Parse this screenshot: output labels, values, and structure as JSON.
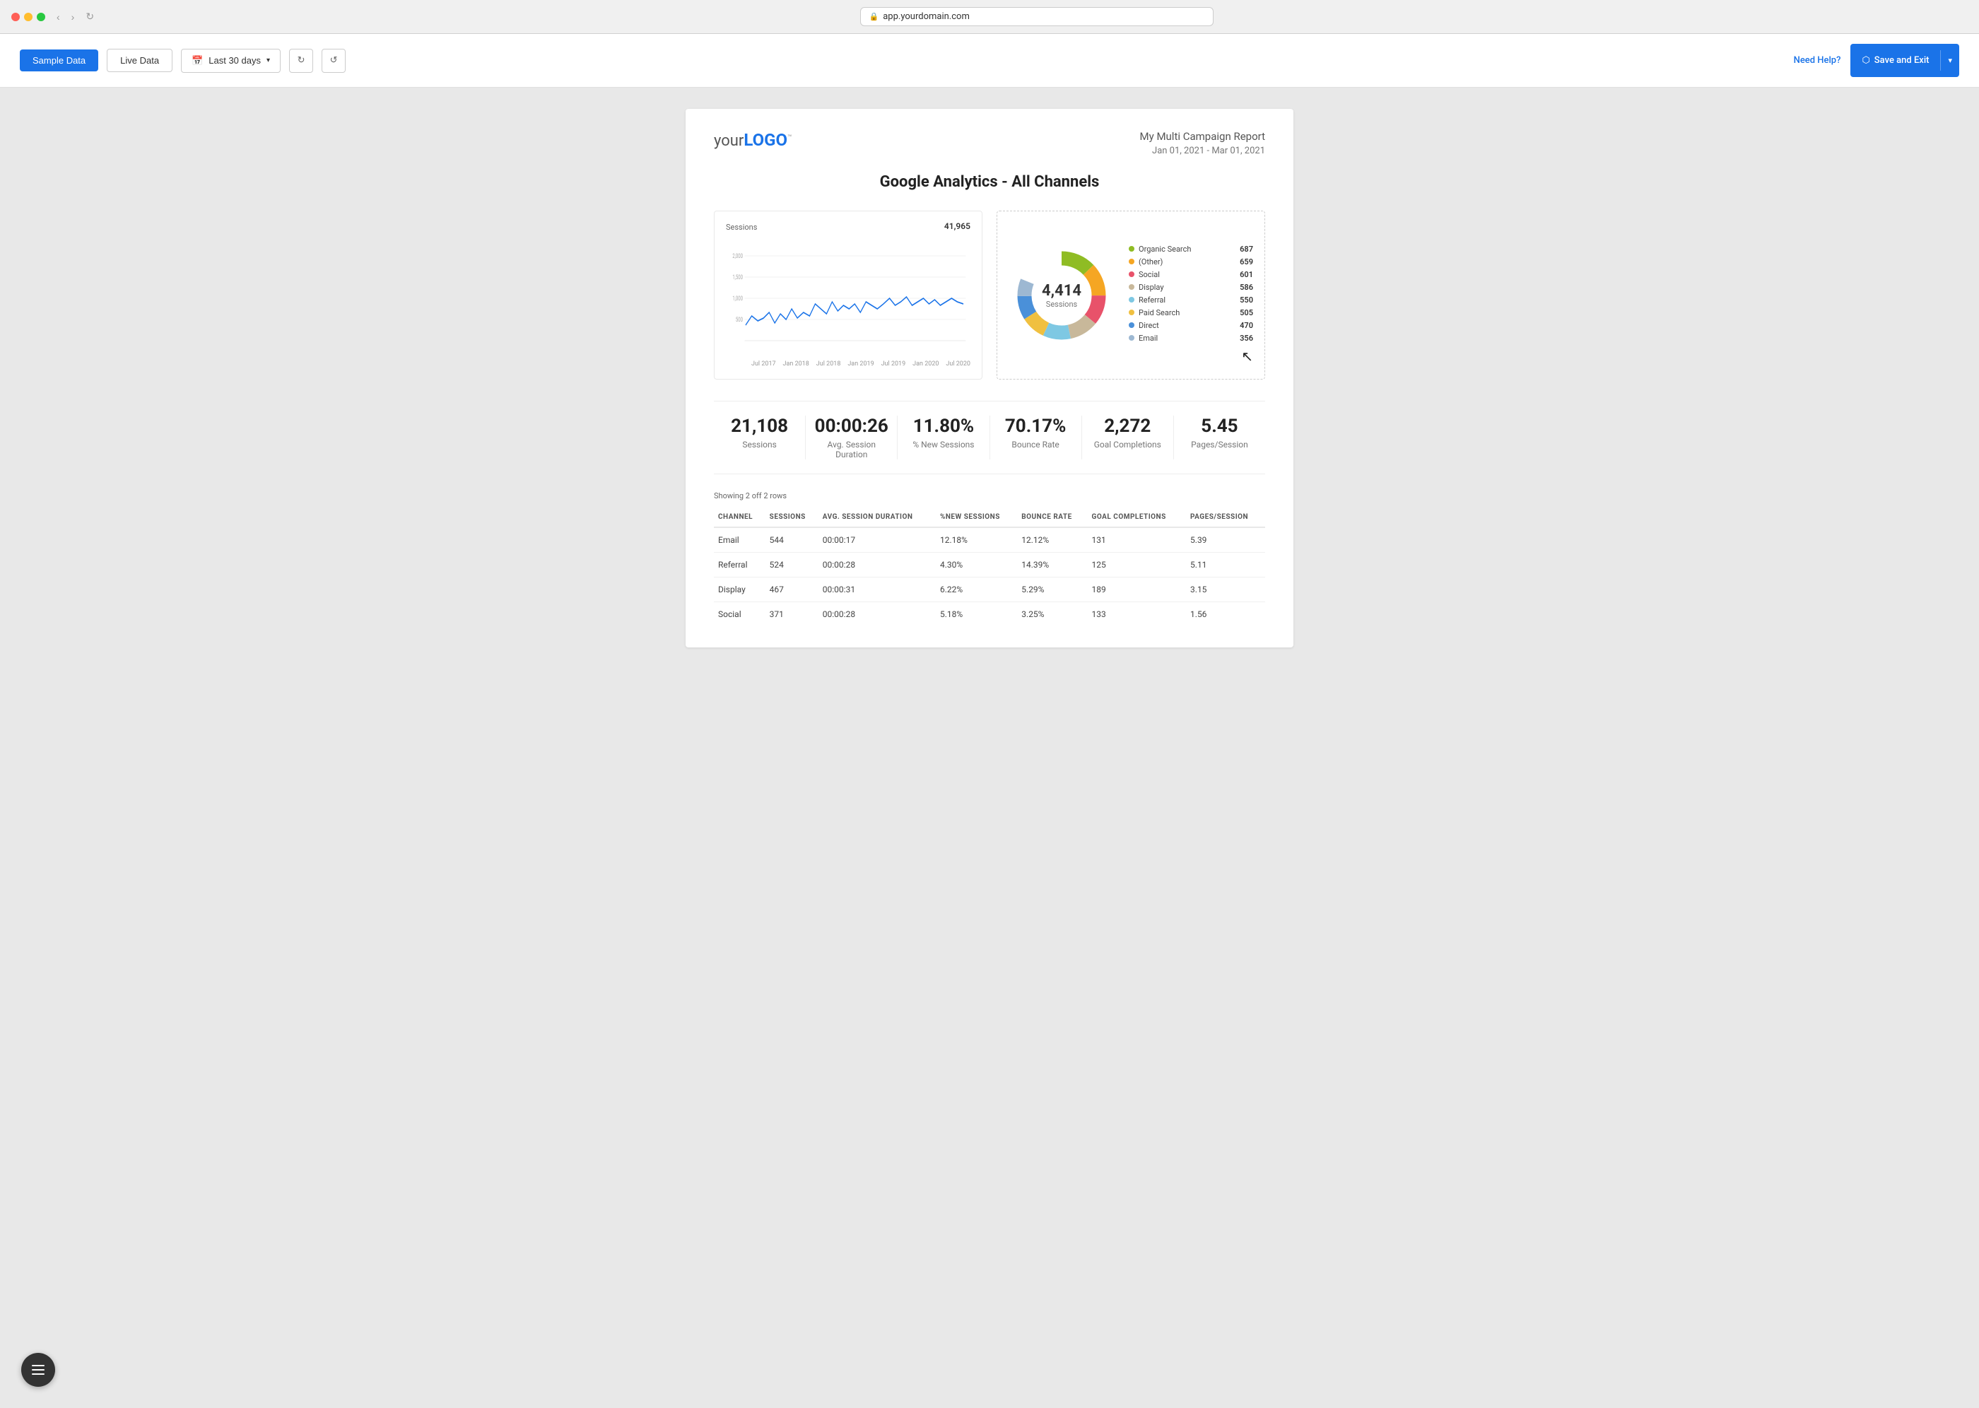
{
  "browser": {
    "url": "app.yourdomain.com"
  },
  "toolbar": {
    "sample_data_label": "Sample Data",
    "live_data_label": "Live Data",
    "date_range_label": "Last 30 days",
    "need_help_label": "Need Help?",
    "save_exit_label": "Save and Exit"
  },
  "report": {
    "logo_text": "your",
    "logo_bold": "LOGO",
    "logo_tm": "™",
    "report_name": "My Multi Campaign Report",
    "report_date": "Jan 01, 2021 - Mar 01, 2021",
    "section_title": "Google Analytics - All Channels"
  },
  "line_chart": {
    "y_label": "Sessions",
    "peak_value": "41,965",
    "y_axis": [
      "2,000",
      "1,500",
      "1,000",
      "500"
    ],
    "x_axis": [
      "Jul 2017",
      "Jan 2018",
      "Jul 2018",
      "Jan 2019",
      "Jul 2019",
      "Jan 2020",
      "Jul 2020"
    ]
  },
  "donut_chart": {
    "center_value": "4,414",
    "center_subtitle": "Sessions",
    "legend": [
      {
        "name": "Organic Search",
        "value": "687",
        "color": "#8fbc24"
      },
      {
        "name": "(Other)",
        "value": "659",
        "color": "#f5a623"
      },
      {
        "name": "Social",
        "value": "601",
        "color": "#e8526a"
      },
      {
        "name": "Display",
        "value": "586",
        "color": "#c8b89a"
      },
      {
        "name": "Referral",
        "value": "550",
        "color": "#7ec8e3"
      },
      {
        "name": "Paid Search",
        "value": "505",
        "color": "#f0c040"
      },
      {
        "name": "Direct",
        "value": "470",
        "color": "#4a90d9"
      },
      {
        "name": "Email",
        "value": "356",
        "color": "#9db8d2"
      }
    ]
  },
  "stats": [
    {
      "value": "21,108",
      "label": "Sessions"
    },
    {
      "value": "00:00:26",
      "label": "Avg. Session Duration"
    },
    {
      "value": "11.80%",
      "label": "% New Sessions"
    },
    {
      "value": "70.17%",
      "label": "Bounce Rate"
    },
    {
      "value": "2,272",
      "label": "Goal Completions"
    },
    {
      "value": "5.45",
      "label": "Pages/Session"
    }
  ],
  "table": {
    "showing_text": "Showing 2 off 2 rows",
    "columns": [
      "Channel",
      "Sessions",
      "Avg. Session Duration",
      "%New Sessions",
      "Bounce Rate",
      "Goal Completions",
      "Pages/Session"
    ],
    "rows": [
      [
        "Email",
        "544",
        "00:00:17",
        "12.18%",
        "12.12%",
        "131",
        "5.39"
      ],
      [
        "Referral",
        "524",
        "00:00:28",
        "4.30%",
        "14.39%",
        "125",
        "5.11"
      ],
      [
        "Display",
        "467",
        "00:00:31",
        "6.22%",
        "5.29%",
        "189",
        "3.15"
      ],
      [
        "Social",
        "371",
        "00:00:28",
        "5.18%",
        "3.25%",
        "133",
        "1.56"
      ]
    ]
  },
  "float_button": {
    "label": "menu"
  }
}
